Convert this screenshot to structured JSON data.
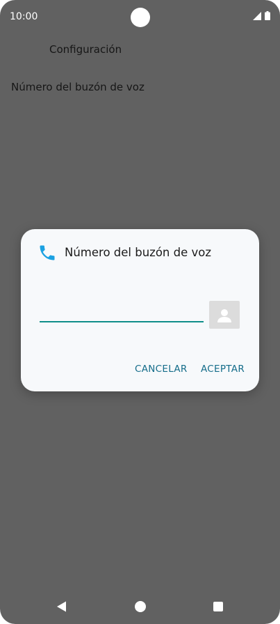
{
  "status_bar": {
    "time": "10:00",
    "icons": [
      "signal-icon",
      "battery-icon"
    ]
  },
  "page": {
    "title": "Configuración",
    "list_item": "Número del buzón de voz"
  },
  "dialog": {
    "icon": "phone-icon",
    "title": "Número del buzón de voz",
    "input_value": "",
    "contact_icon": "contact-picker-icon",
    "cancel_label": "CANCELAR",
    "accept_label": "ACEPTAR"
  },
  "navigation": {
    "icons": [
      "back-icon",
      "home-icon",
      "recents-icon"
    ]
  },
  "colors": {
    "scrim": "#616161",
    "dialog_background": "#f7f9fb",
    "accent": "#0f8e89",
    "button_text": "#156d8a",
    "phone_icon": "#1ba1e2"
  }
}
